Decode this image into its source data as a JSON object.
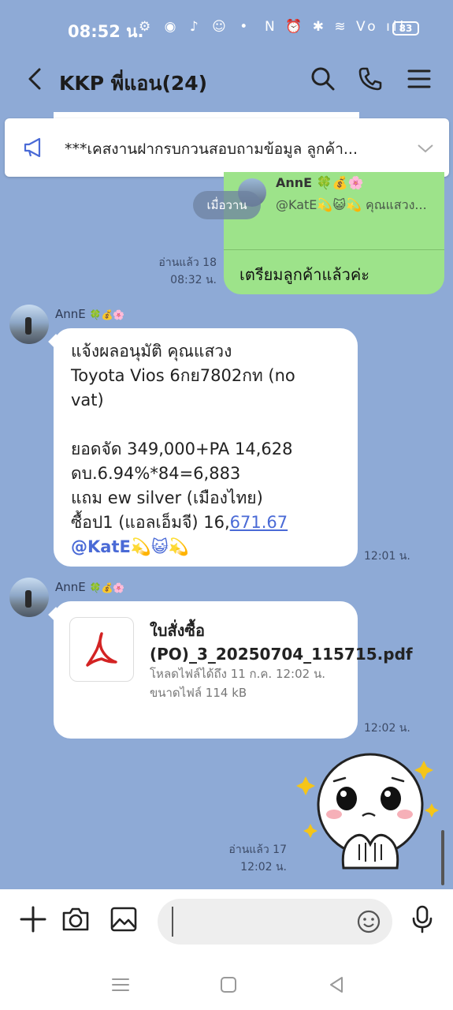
{
  "status_bar": {
    "time": "08:52 น.",
    "left_icons": "⚙ ◉ ♪ ☺ •",
    "right_icons": "N ⏰ ✱ ≋ Vo ıll",
    "battery": "83"
  },
  "header": {
    "title": "KKP พี่แอน(24)"
  },
  "announcement": {
    "text": "***เคสงานฝากรบกวนสอบถามข้อมูล ลูกค้า..."
  },
  "date_divider": "เมื่อวาน",
  "my_message": {
    "quote_name": "AnnE 🍀💰🌸",
    "quote_text": "@KatE💫😺💫 คุณแสวง...",
    "text": "เตรียมลูกค้าแล้วค่ะ",
    "read_status": "อ่านแล้ว 18",
    "time": "08:32 น."
  },
  "messages": [
    {
      "sender": "AnnE",
      "sender_emoji": "🍀💰🌸",
      "lines": [
        "แจ้งผลอนุมัติ คุณแสวง",
        "Toyota Vios 6กย7802กท (no",
        "vat)",
        "",
        "ยอดจัด 349,000+PA 14,628",
        "ดบ.6.94%*84=6,883",
        "แถม ew silver (เมืองไทย)",
        "ซื้อป1 (แอลเอ็มจี) 16,"
      ],
      "link_text": "671.67",
      "mention": "@KatE💫😺💫",
      "time": "12:01 น."
    },
    {
      "sender": "AnnE",
      "sender_emoji": "🍀💰🌸",
      "file_name": "ใบสั่งซื้อ (PO)_3_20250704_115715.pdf",
      "file_expiry": "โหลดไฟล์ได้ถึง 11 ก.ค. 12:02 น.",
      "file_size": "ขนาดไฟล์ 114 kB",
      "time": "12:02 น."
    }
  ],
  "my_sticker": {
    "read_status": "อ่านแล้ว 17",
    "time": "12:02 น."
  },
  "input": {
    "placeholder": ""
  },
  "colors": {
    "chat_bg": "#8eaad6",
    "my_bubble": "#9de38a",
    "link": "#4a6ad6"
  }
}
